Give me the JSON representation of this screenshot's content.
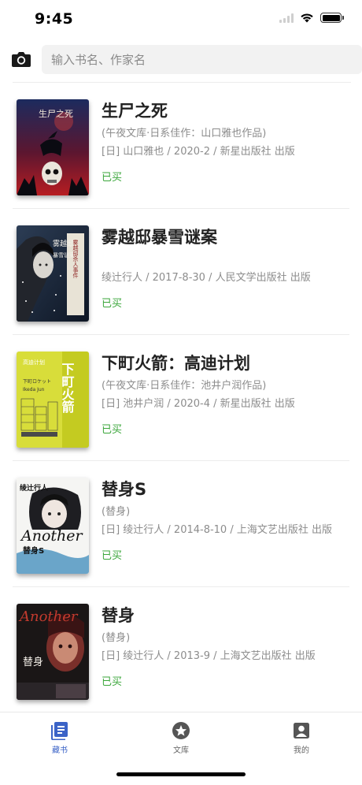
{
  "status_bar": {
    "time": "9:45"
  },
  "search": {
    "placeholder": "输入书名、作家名"
  },
  "books": [
    {
      "title": "生尸之死",
      "series": "(午夜文库·日系佳作：山口雅也作品)",
      "meta": "[日] 山口雅也 / 2020-2 / 新星出版社 出版",
      "status": "已买"
    },
    {
      "title": "雾越邸暴雪谜案",
      "series": "",
      "meta": "绫辻行人 / 2017-8-30 / 人民文学出版社 出版",
      "status": "已买"
    },
    {
      "title": "下町火箭：高迪计划",
      "series": "(午夜文库·日系佳作：池井户润作品)",
      "meta": "[日] 池井户润 / 2020-4 / 新星出版社 出版",
      "status": "已买"
    },
    {
      "title": "替身S",
      "series": "(替身)",
      "meta": "[日] 绫辻行人 / 2014-8-10 / 上海文艺出版社 出版",
      "status": "已买"
    },
    {
      "title": "替身",
      "series": "(替身)",
      "meta": "[日] 绫辻行人 / 2013-9 / 上海文艺出版社 出版",
      "status": "已买"
    }
  ],
  "covers": {
    "book1": "生尸之死",
    "book2": {
      "title": "雾越邸",
      "subtitle": "暴雪谜案",
      "side": "雾越邸杀人事件"
    },
    "book3": {
      "vertical": "下町火箭",
      "small": "高迪计划",
      "jp": "下町ロケット",
      "author": "Ikeda Jun"
    },
    "book4": {
      "author": "绫辻行人",
      "latin": "Another",
      "title": "替身S"
    },
    "book5": {
      "latin": "Another",
      "title": "替身"
    }
  },
  "tabs": [
    {
      "label": "藏书",
      "icon": "bookshelf-icon",
      "active": true
    },
    {
      "label": "文库",
      "icon": "star-badge-icon",
      "active": false
    },
    {
      "label": "我的",
      "icon": "profile-icon",
      "active": false
    }
  ],
  "colors": {
    "accent": "#3b63c7",
    "status_green": "#3aa63a",
    "text_secondary": "#8c8c8c"
  }
}
